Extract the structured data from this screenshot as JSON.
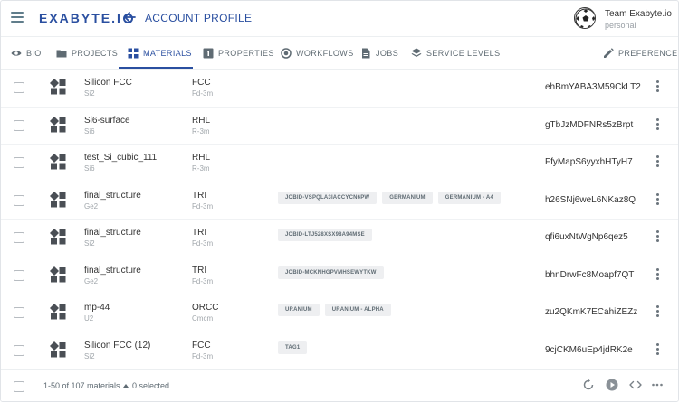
{
  "app": {
    "logo_text": "EXABYTE.I",
    "page_title": "ACCOUNT PROFILE",
    "team_name": "Team Exabyte.io",
    "team_type": "personal"
  },
  "tabs": [
    {
      "label": "BIO",
      "icon": "eye-icon"
    },
    {
      "label": "PROJECTS",
      "icon": "folder-icon"
    },
    {
      "label": "MATERIALS",
      "icon": "grid-icon",
      "active": true
    },
    {
      "label": "PROPERTIES",
      "icon": "property-icon"
    },
    {
      "label": "WORKFLOWS",
      "icon": "workflow-icon"
    },
    {
      "label": "JOBS",
      "icon": "file-icon"
    },
    {
      "label": "SERVICE LEVELS",
      "icon": "layers-icon"
    },
    {
      "label": "PREFERENCES",
      "icon": "pencil-icon"
    }
  ],
  "materials": [
    {
      "name": "Silicon FCC",
      "formula": "Si2",
      "lattice": "FCC",
      "spacegroup": "Fd-3m",
      "tags": [],
      "hash": "ehBmYABA3M59CkLT2"
    },
    {
      "name": "Si6-surface",
      "formula": "Si6",
      "lattice": "RHL",
      "spacegroup": "R-3m",
      "tags": [],
      "hash": "gTbJzMDFNRs5zBrpt"
    },
    {
      "name": "test_Si_cubic_111",
      "formula": "Si6",
      "lattice": "RHL",
      "spacegroup": "R-3m",
      "tags": [],
      "hash": "FfyMapS6yyxhHTyH7"
    },
    {
      "name": "final_structure",
      "formula": "Ge2",
      "lattice": "TRI",
      "spacegroup": "Fd-3m",
      "tags": [
        "JOBID-VSPQLA3IACCYCN6PW",
        "GERMANIUM",
        "GERMANIUM - A4"
      ],
      "hash": "h26SNj6weL6NKaz8Q"
    },
    {
      "name": "final_structure",
      "formula": "Si2",
      "lattice": "TRI",
      "spacegroup": "Fd-3m",
      "tags": [
        "JOBID-LTJ528XSX98A94MSE"
      ],
      "hash": "qfi6uxNtWgNp6qez5"
    },
    {
      "name": "final_structure",
      "formula": "Ge2",
      "lattice": "TRI",
      "spacegroup": "Fd-3m",
      "tags": [
        "JOBID-MCKNHGPVMHSEWYTKW"
      ],
      "hash": "bhnDrwFc8Moapf7QT"
    },
    {
      "name": "mp-44",
      "formula": "U2",
      "lattice": "ORCC",
      "spacegroup": "Cmcm",
      "tags": [
        "URANIUM",
        "URANIUM - ALPHA"
      ],
      "hash": "zu2QKmK7ECahiZEZz"
    },
    {
      "name": "Silicon FCC (12)",
      "formula": "Si2",
      "lattice": "FCC",
      "spacegroup": "Fd-3m",
      "tags": [
        "TAG1"
      ],
      "hash": "9cjCKM6uEp4jdRK2e"
    }
  ],
  "footer": {
    "range_label": "1-50 of 107 materials",
    "selected_label": "0 selected"
  },
  "colors": {
    "brand": "#2a4fa0",
    "muted_text": "#a0a6ab",
    "tag_bg": "#eeeff1"
  }
}
